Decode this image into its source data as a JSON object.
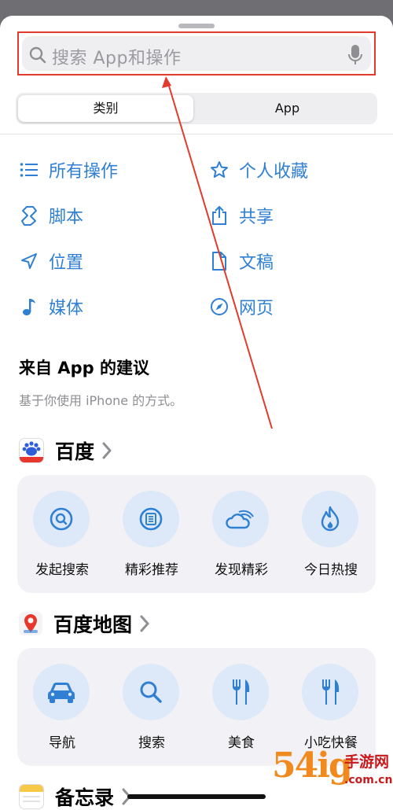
{
  "search": {
    "placeholder": "搜索 App和操作"
  },
  "segment": {
    "active": "类别",
    "inactive": "App"
  },
  "categories": [
    {
      "label": "所有操作",
      "icon": "list-icon"
    },
    {
      "label": "个人收藏",
      "icon": "star-icon"
    },
    {
      "label": "脚本",
      "icon": "scripting-icon"
    },
    {
      "label": "共享",
      "icon": "share-icon"
    },
    {
      "label": "位置",
      "icon": "location-arrow-icon"
    },
    {
      "label": "文稿",
      "icon": "document-icon"
    },
    {
      "label": "媒体",
      "icon": "music-note-icon"
    },
    {
      "label": "网页",
      "icon": "compass-icon"
    }
  ],
  "suggestions": {
    "title": "来自 App 的建议",
    "subtitle": "基于你使用 iPhone 的方式。"
  },
  "apps": [
    {
      "name": "百度",
      "actions": [
        {
          "label": "发起搜索",
          "icon": "search-icon"
        },
        {
          "label": "精彩推荐",
          "icon": "newspaper-icon"
        },
        {
          "label": "发现精彩",
          "icon": "cloud-rainbow-icon"
        },
        {
          "label": "今日热搜",
          "icon": "flame-icon"
        }
      ]
    },
    {
      "name": "百度地图",
      "actions": [
        {
          "label": "导航",
          "icon": "car-icon"
        },
        {
          "label": "搜索",
          "icon": "search-icon"
        },
        {
          "label": "美食",
          "icon": "fork-knife-icon"
        },
        {
          "label": "小吃快餐",
          "icon": "fork-knife-icon"
        }
      ]
    },
    {
      "name": "备忘录"
    }
  ],
  "watermark": {
    "number": "54ig",
    "cn": "手游网",
    "url": ".com.cn"
  },
  "colors": {
    "accent": "#2f7fd3",
    "highlight": "#e23b2e",
    "card": "#f2f2f6",
    "icon_bg": "#dde9f8"
  }
}
